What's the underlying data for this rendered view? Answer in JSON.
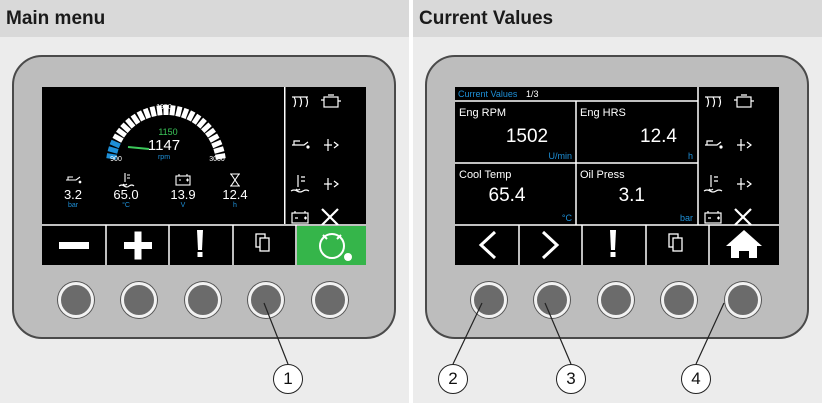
{
  "left_panel": {
    "title": "Main menu",
    "gauge": {
      "label_top": "1950",
      "label_min": "900",
      "label_max": "3000",
      "setpoint": "1150",
      "value": "1147",
      "unit": "rpm",
      "fill_fraction": 0.12
    },
    "readouts": [
      {
        "icon": "oil-can-icon",
        "value": "3.2",
        "unit": "bar"
      },
      {
        "icon": "thermometer-icon",
        "value": "65.0",
        "unit": "°C"
      },
      {
        "icon": "battery-icon",
        "value": "13.9",
        "unit": "V"
      },
      {
        "icon": "hourglass-icon",
        "value": "12.4",
        "unit": "h"
      }
    ],
    "softkeys": [
      "minus",
      "plus",
      "warning",
      "copy",
      "engine-start"
    ],
    "callout": "1"
  },
  "right_panel": {
    "title": "Current Values",
    "screen_title": "Current Values",
    "page_indicator": "1/3",
    "cells": [
      {
        "label": "Eng RPM",
        "value": "1502",
        "unit": "U/min"
      },
      {
        "label": "Eng HRS",
        "value": "12.4",
        "unit": "h"
      },
      {
        "label": "Cool Temp",
        "value": "65.4",
        "unit": "°C"
      },
      {
        "label": "Oil Press",
        "value": "3.1",
        "unit": "bar"
      }
    ],
    "softkeys": [
      "back",
      "forward",
      "warning",
      "copy",
      "home"
    ],
    "callouts": [
      "2",
      "3",
      "4"
    ]
  },
  "colors": {
    "accent_blue": "#1e90d8",
    "setpoint_green": "#3cc85a",
    "active_key_green": "#35b54a",
    "panel_header": "#d9d9d9"
  }
}
